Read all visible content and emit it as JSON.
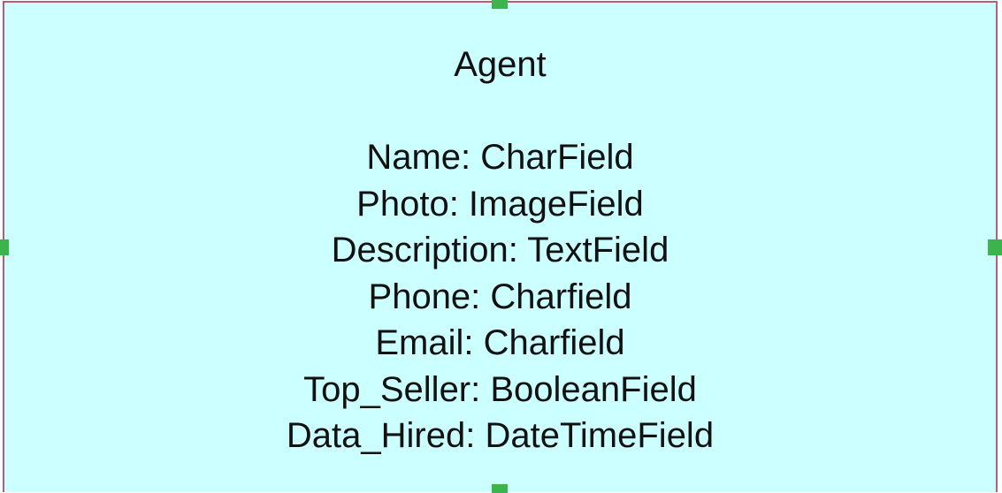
{
  "entity": {
    "title": "Agent",
    "fields": [
      "Name: CharField",
      "Photo: ImageField",
      "Description: TextField",
      "Phone: Charfield",
      "Email: Charfield",
      "Top_Seller: BooleanField",
      "Data_Hired: DateTimeField"
    ]
  },
  "colors": {
    "box_fill": "#ccffff",
    "box_border": "#b85c7a",
    "selection_handle": "#3cb44b",
    "text": "#111111"
  },
  "selection": {
    "selected": true
  }
}
